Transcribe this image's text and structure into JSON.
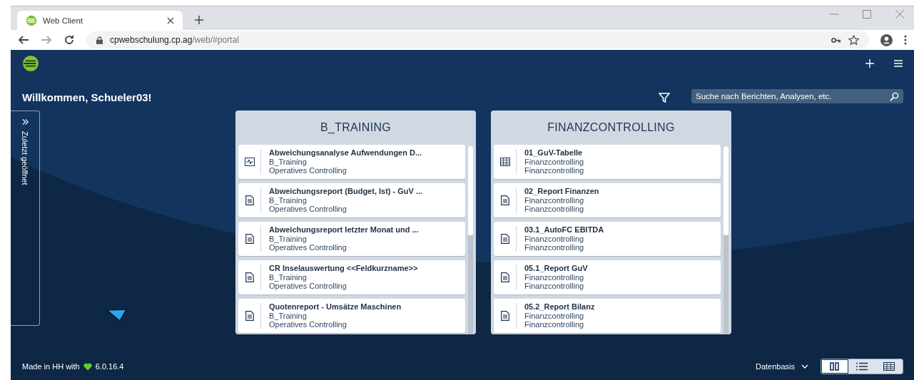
{
  "browser": {
    "tab_title": "Web Client",
    "url_host": "cpwebschulung.cp.ag",
    "url_path": "/web/#portal"
  },
  "app": {
    "welcome": "Willkommen, Schueler03!",
    "search": {
      "placeholder": "Suche nach Berichten, Analysen, etc."
    },
    "recent_panel": {
      "label": "Zuletzt geöffnet",
      "expanded": false
    }
  },
  "panels": [
    {
      "title": "B_TRAINING",
      "items": [
        {
          "kind": "chart",
          "title": "Abweichungsanalyse Aufwendungen D...",
          "line_2": "B_Training",
          "line_3": "Operatives Controlling"
        },
        {
          "kind": "report",
          "title": "Abweichungsreport (Budget, Ist) - GuV ...",
          "line_2": "B_Training",
          "line_3": "Operatives Controlling"
        },
        {
          "kind": "report",
          "title": "Abweichungsreport letzter Monat und ...",
          "line_2": "B_Training",
          "line_3": "Operatives Controlling"
        },
        {
          "kind": "report",
          "title": "CR Inselauswertung <<Feldkurzname>>",
          "line_2": "B_Training",
          "line_3": "Operatives Controlling"
        },
        {
          "kind": "report",
          "title": "Quotenreport - Umsätze Maschinen",
          "line_2": "B_Training",
          "line_3": "Operatives Controlling"
        }
      ]
    },
    {
      "title": "FINANZCONTROLLING",
      "items": [
        {
          "kind": "table",
          "title": "01_GuV-Tabelle",
          "line_2": "Finanzcontrolling",
          "line_3": "Finanzcontrolling"
        },
        {
          "kind": "report",
          "title": "02_Report Finanzen",
          "line_2": "Finanzcontrolling",
          "line_3": "Finanzcontrolling"
        },
        {
          "kind": "report",
          "title": "03.1_AutoFC EBITDA",
          "line_2": "Finanzcontrolling",
          "line_3": "Finanzcontrolling"
        },
        {
          "kind": "report",
          "title": "05.1_Report GuV",
          "line_2": "Finanzcontrolling",
          "line_3": "Finanzcontrolling"
        },
        {
          "kind": "report",
          "title": "05.2_Report Bilanz",
          "line_2": "Finanzcontrolling",
          "line_3": "Finanzcontrolling"
        }
      ]
    }
  ],
  "footer": {
    "made_in": "Made in HH with",
    "version": "6.0.16.4",
    "database": "Datenbasis",
    "views": [
      {
        "kind": "columns",
        "selected": true
      },
      {
        "kind": "list",
        "selected": false
      },
      {
        "kind": "table",
        "selected": false
      }
    ]
  }
}
